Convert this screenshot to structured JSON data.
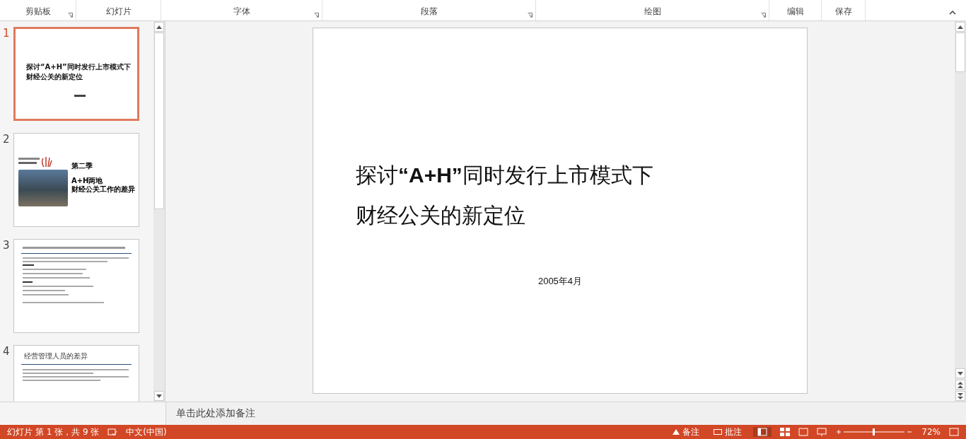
{
  "ribbon": {
    "groups": [
      {
        "label": "剪贴板",
        "launcher": true
      },
      {
        "label": "幻灯片",
        "launcher": false
      },
      {
        "label": "字体",
        "launcher": true
      },
      {
        "label": "段落",
        "launcher": true
      },
      {
        "label": "绘图",
        "launcher": true
      },
      {
        "label": "编辑",
        "launcher": false
      },
      {
        "label": "保存",
        "launcher": false
      }
    ]
  },
  "thumbnails": [
    {
      "number": "1",
      "selected": true,
      "kind": "title",
      "title_lines": [
        "探讨“A+H”同时发行上市模式下",
        "财经公关的新定位"
      ]
    },
    {
      "number": "2",
      "selected": false,
      "kind": "section",
      "heading": "第二季",
      "lines": [
        "A+H两地",
        "财经公关工作的差异"
      ]
    },
    {
      "number": "3",
      "selected": false,
      "kind": "text"
    },
    {
      "number": "4",
      "selected": false,
      "kind": "text",
      "heading": "经营管理人员的差异"
    }
  ],
  "slide": {
    "title_lines": [
      "探讨**“A+H”**同时发行上市模式下",
      "财经公关的新定位"
    ],
    "date": "2005年4月"
  },
  "notes": {
    "placeholder": "单击此处添加备注"
  },
  "status_bar": {
    "slide_info": "幻灯片 第 1 张，共 9 张",
    "language": "中文(中国)",
    "notes": "备注",
    "comments": "批注",
    "zoom": "72%"
  }
}
